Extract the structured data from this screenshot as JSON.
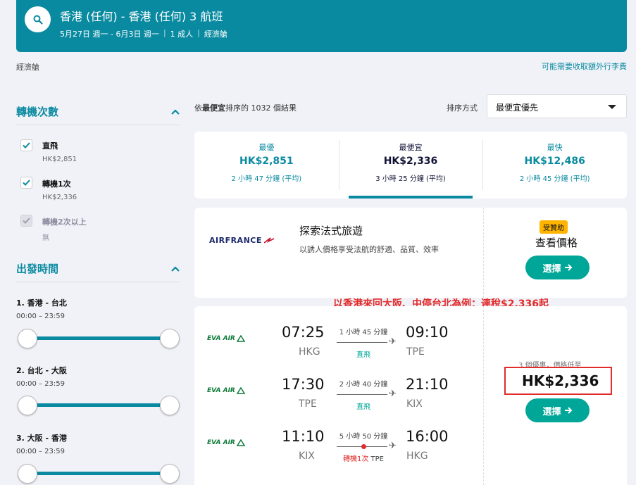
{
  "header": {
    "title": "香港 (任何) - 香港 (任何) 3 航班",
    "dates": "5月27日 週一 - 6月3日 週一",
    "travellers": "1 成人",
    "cabin": "經濟艙"
  },
  "cabin_label": "經濟艙",
  "fee_link": "可能需要收取額外行李費",
  "stops_filter": {
    "title": "轉機次數",
    "options": [
      {
        "label": "直飛",
        "price": "HK$2,851",
        "checked": true
      },
      {
        "label": "轉機1次",
        "price": "HK$2,336",
        "checked": true
      },
      {
        "label": "轉機2次以上",
        "price": "無",
        "checked": true,
        "disabled": true
      }
    ]
  },
  "time_filter": {
    "title": "出發時間",
    "legs": [
      {
        "label": "1. 香港 - 台北",
        "range": "00:00 – 23:59"
      },
      {
        "label": "2. 台北 - 大阪",
        "range": "00:00 – 23:59"
      },
      {
        "label": "3. 大阪 - 香港",
        "range": "00:00 – 23:59"
      }
    ]
  },
  "results": {
    "count_prefix": "依",
    "count_bold": "最便宜",
    "count_suffix": "排序的 1032 個結果",
    "sort_label": "排序方式",
    "sort_value": "最便宜優先"
  },
  "tabs": [
    {
      "title": "最優",
      "price": "HK$2,851",
      "duration": "2 小時 47 分鐘 (平均)",
      "active": false
    },
    {
      "title": "最便宜",
      "price": "HK$2,336",
      "duration": "3 小時 25 分鐘 (平均)",
      "active": true
    },
    {
      "title": "最快",
      "price": "HK$12,486",
      "duration": "2 小時 45 分鐘 (平均)",
      "active": false
    }
  ],
  "ad": {
    "logo": "AIRFRANCE",
    "title": "探索法式旅遊",
    "desc": "以誘人價格享受法航的舒適、品質、效率",
    "badge": "受贊助",
    "check_price": "查看價格",
    "select": "選擇"
  },
  "annotation": "以香港來回大阪、中停台北為例：連稅$2,336起",
  "flight": {
    "legs": [
      {
        "airline": "EVA AIR",
        "dep_time": "07:25",
        "dep_code": "HKG",
        "duration": "1 小時 45 分鐘",
        "arr_time": "09:10",
        "arr_code": "TPE",
        "stops": "直飛"
      },
      {
        "airline": "EVA AIR",
        "dep_time": "17:30",
        "dep_code": "TPE",
        "duration": "2 小時 40 分鐘",
        "arr_time": "21:10",
        "arr_code": "KIX",
        "stops": "直飛"
      },
      {
        "airline": "EVA AIR",
        "dep_time": "11:10",
        "dep_code": "KIX",
        "duration": "5 小時 50 分鐘",
        "arr_time": "16:00",
        "arr_code": "HKG",
        "stops_red": "轉機1次",
        "stops_via": "TPE"
      }
    ],
    "deals": "3 個優惠，價格低至",
    "price": "HK$2,336",
    "select": "選擇"
  },
  "colors": {
    "accent": "#0a8aa0",
    "green": "#00a698",
    "highlight": "#e22b2b"
  }
}
